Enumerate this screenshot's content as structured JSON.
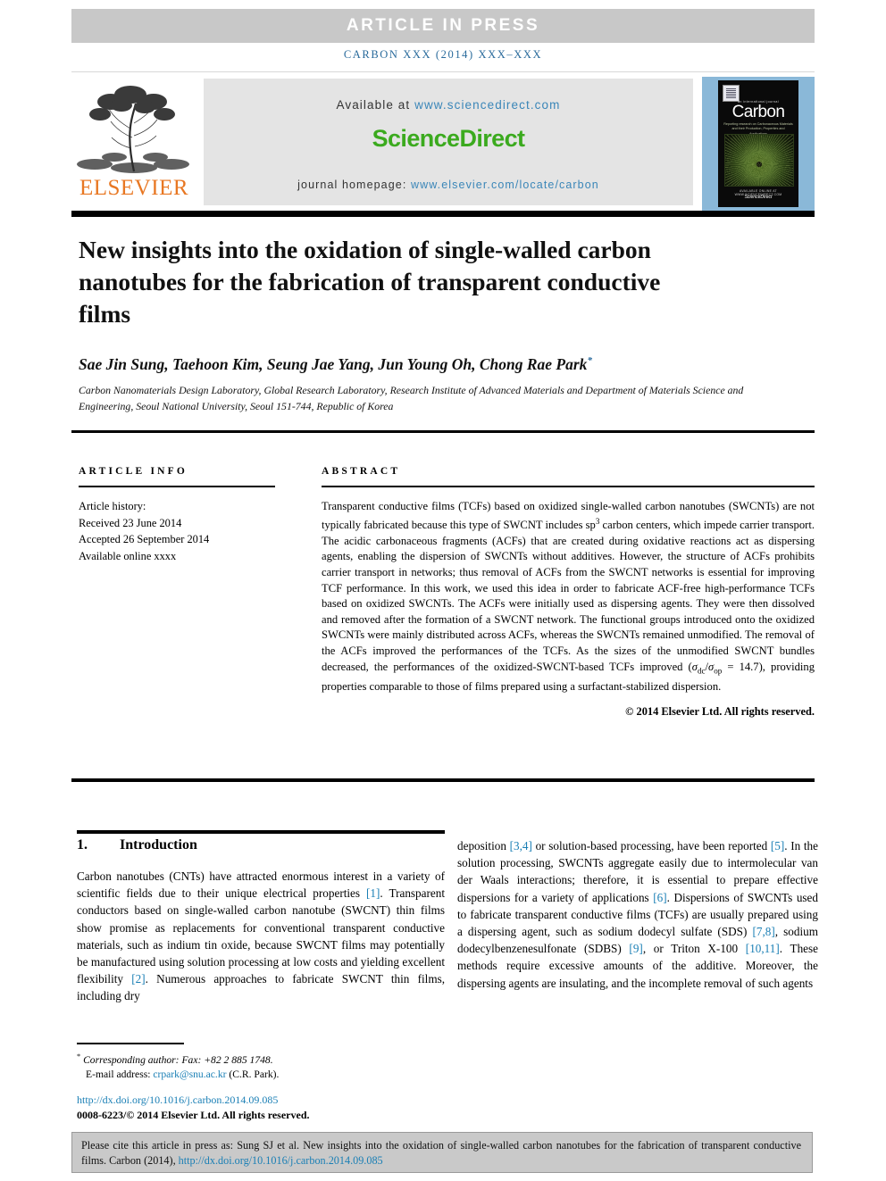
{
  "header": {
    "article_in_press": "ARTICLE  IN  PRESS",
    "running_head": "CARBON XXX (2014) XXX–XXX"
  },
  "masthead": {
    "publisher": "ELSEVIER",
    "available_label": "Available at ",
    "available_url": "www.sciencedirect.com",
    "sciencedirect": "ScienceDirect",
    "homepage_label": "journal homepage: ",
    "homepage_url": "www.elsevier.com/locate/carbon",
    "cover": {
      "supertitle": "an international journal",
      "title": "Carbon",
      "tagline": "Reporting research on Carbonaceous Materials and their Production, Properties and Applications",
      "foot_small": "AVAILABLE ONLINE AT WWW.SCIENCEDIRECT.COM",
      "foot_brand": "ScienceDirect"
    }
  },
  "article": {
    "title": "New insights into the oxidation of single-walled carbon nanotubes for the fabrication of transparent conductive films",
    "authors": "Sae Jin Sung, Taehoon Kim, Seung Jae Yang, Jun Young Oh, Chong Rae Park",
    "corresponding_marker": "*",
    "affiliation": "Carbon Nanomaterials Design Laboratory, Global Research Laboratory, Research Institute of Advanced Materials and Department of Materials Science and Engineering, Seoul National University, Seoul 151-744, Republic of Korea"
  },
  "article_info": {
    "heading": "ARTICLE INFO",
    "history_label": "Article history:",
    "received": "Received 23 June 2014",
    "accepted": "Accepted 26 September 2014",
    "available_online": "Available online xxxx"
  },
  "abstract": {
    "heading": "ABSTRACT",
    "part1": "Transparent conductive films (TCFs) based on oxidized single-walled carbon nanotubes (SWCNTs) are not typically fabricated because this type of SWCNT includes sp",
    "sp_exp": "3",
    "part2": " carbon centers, which impede carrier transport. The acidic carbonaceous fragments (ACFs) that are created during oxidative reactions act as dispersing agents, enabling the dispersion of SWCNTs without additives. However, the structure of ACFs prohibits carrier transport in networks; thus removal of ACFs from the SWCNT networks is essential for improving TCF performance. In this work, we used this idea in order to fabricate ACF-free high-performance TCFs based on oxidized SWCNTs. The ACFs were initially used as dispersing agents. They were then dissolved and removed after the formation of a SWCNT network. The functional groups introduced onto the oxidized SWCNTs were mainly distributed across ACFs, whereas the SWCNTs remained unmodified. The removal of the ACFs improved the performances of the TCFs. As the sizes of the unmodified SWCNT bundles decreased, the performances of the oxidized-SWCNT-based TCFs improved (",
    "sigma1": "σ",
    "sigma1_sub": "dc",
    "sigma_slash": "/",
    "sigma2": "σ",
    "sigma2_sub": "op",
    "sigma_value": " = 14.7), providing properties comparable to those of films prepared using a surfactant-stabilized dispersion.",
    "copyright": "© 2014 Elsevier Ltd. All rights reserved."
  },
  "body": {
    "section_number": "1.",
    "section_title": "Introduction",
    "left_p1_a": "Carbon nanotubes (CNTs) have attracted enormous interest in a variety of scientific fields due to their unique electrical properties ",
    "left_cite1": "[1]",
    "left_p1_b": ". Transparent conductors based on single-walled carbon nanotube (SWCNT) thin films show promise as replacements for conventional transparent conductive materials, such as indium tin oxide, because SWCNT films may potentially be manufactured using solution processing at low costs and yielding excellent flexibility ",
    "left_cite2": "[2]",
    "left_p1_c": ". Numerous approaches to fabricate SWCNT thin films, including dry",
    "right_a": "deposition ",
    "right_cite1": "[3,4]",
    "right_b": " or solution-based processing, have been reported ",
    "right_cite2": "[5]",
    "right_c": ". In the solution processing, SWCNTs aggregate easily due to intermolecular van der Waals interactions; therefore, it is essential to prepare effective dispersions for a variety of applications ",
    "right_cite3": "[6]",
    "right_d": ". Dispersions of SWCNTs used to fabricate transparent conductive films (TCFs) are usually prepared using a dispersing agent, such as sodium dodecyl sulfate (SDS) ",
    "right_cite4": "[7,8]",
    "right_e": ", sodium dodecylbenzenesulfonate (SDBS) ",
    "right_cite5": "[9]",
    "right_f": ", or Triton X-100 ",
    "right_cite6": "[10,11]",
    "right_g": ". These methods require excessive amounts of the additive. Moreover, the dispersing agents are insulating, and the incomplete removal of such agents"
  },
  "footnote": {
    "corresponding": "Corresponding author: Fax: +82 2 885 1748.",
    "email_label": "E-mail address: ",
    "email": "crpark@snu.ac.kr",
    "email_suffix": " (C.R. Park).",
    "doi": "http://dx.doi.org/10.1016/j.carbon.2014.09.085",
    "issn": "0008-6223/© 2014 Elsevier Ltd. All rights reserved."
  },
  "cite_box": {
    "text_a": "Please cite this article in press as: Sung SJ et al. New insights into the oxidation of single-walled carbon nanotubes for the fabrication of transparent conductive films. Carbon (2014), ",
    "link": "http://dx.doi.org/10.1016/j.carbon.2014.09.085"
  },
  "colors": {
    "banner_gray": "#c8c8c8",
    "link_blue": "#1a7fb5",
    "elsevier_orange": "#e87722",
    "sciencedirect_green": "#3baa1e",
    "cover_blue": "#8ab8d8"
  }
}
